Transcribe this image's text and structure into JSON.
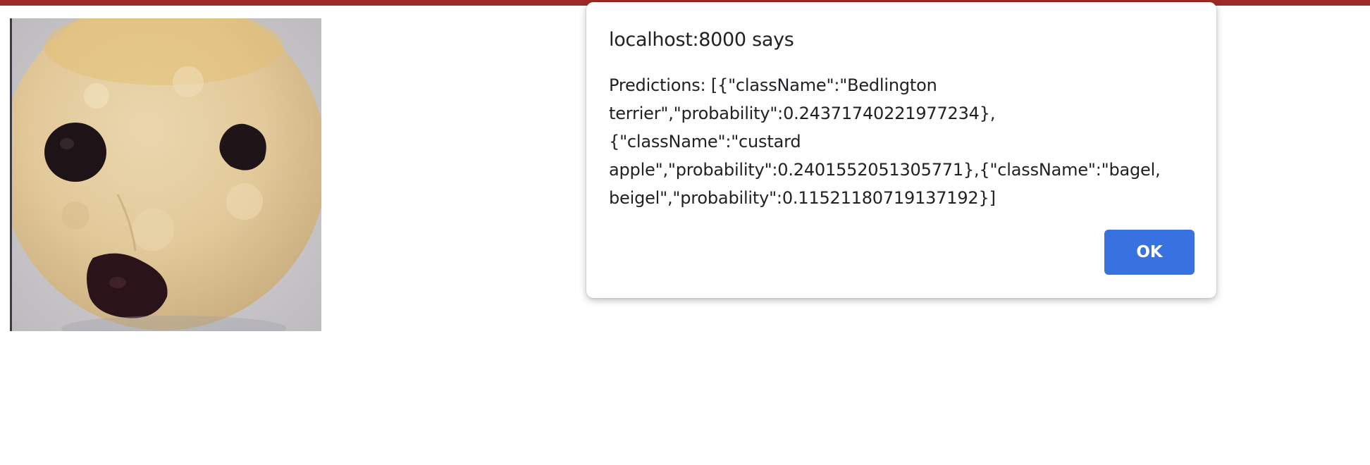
{
  "dialog": {
    "title": "localhost:8000 says",
    "message": "Predictions: [{\"className\":\"Bedlington terrier\",\"probability\":0.24371740221977234},{\"className\":\"custard apple\",\"probability\":0.2401552051305771},{\"className\":\"bagel, beigel\",\"probability\":0.11521180719137192}]",
    "ok_label": "OK"
  },
  "colors": {
    "top_bar": "#9e2b25",
    "ok_button": "#3871e0"
  }
}
